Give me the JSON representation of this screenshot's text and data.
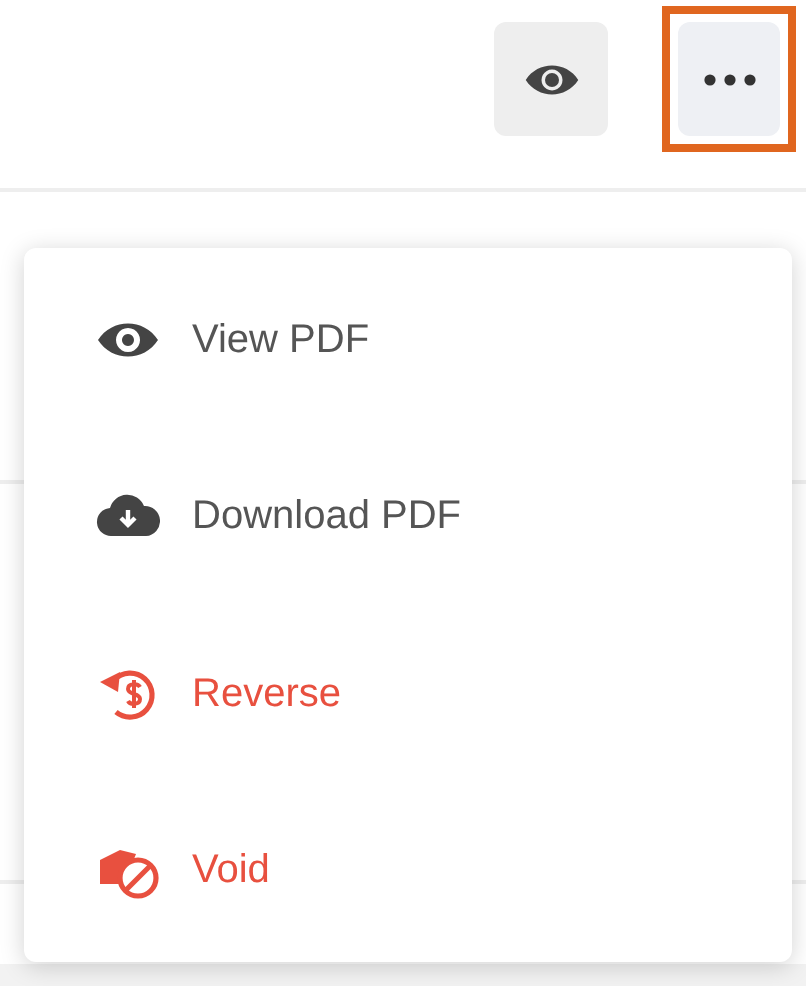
{
  "toolbar": {
    "buttons": [
      {
        "kind": "view",
        "highlighted": false
      },
      {
        "kind": "more",
        "highlighted": true
      }
    ]
  },
  "menu": {
    "items": [
      {
        "label": "View PDF",
        "kind": "view",
        "danger": false
      },
      {
        "label": "Download PDF",
        "kind": "download",
        "danger": false
      },
      {
        "label": "Reverse",
        "kind": "reverse",
        "danger": true
      },
      {
        "label": "Void",
        "kind": "void",
        "danger": true
      }
    ]
  }
}
